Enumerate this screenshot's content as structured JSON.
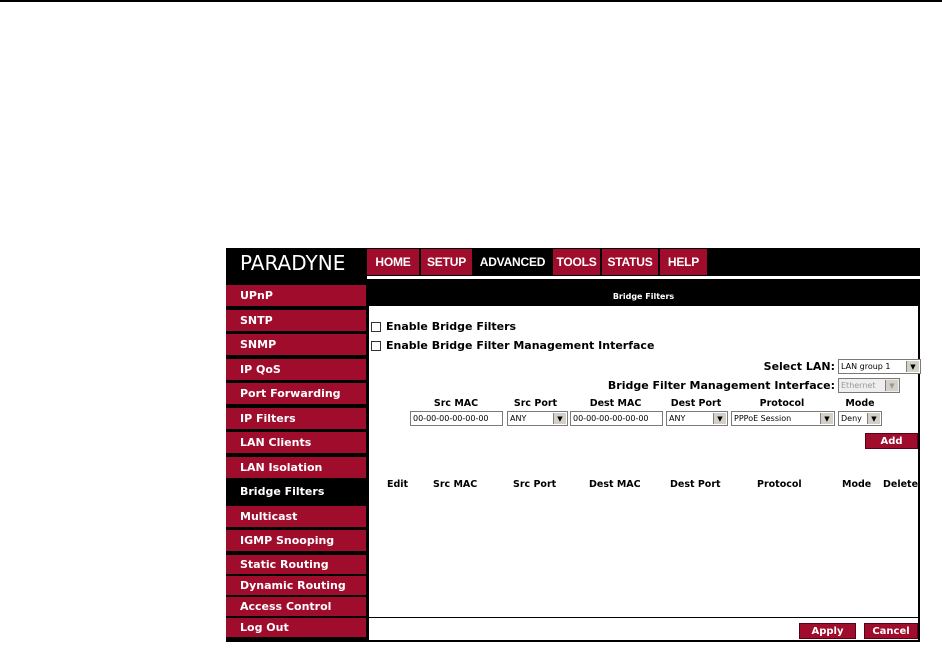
{
  "brand": {
    "logo": "PARADYNE"
  },
  "nav": {
    "tabs": [
      {
        "label": "HOME",
        "active": false
      },
      {
        "label": "SETUP",
        "active": false
      },
      {
        "label": "ADVANCED",
        "active": true
      },
      {
        "label": "TOOLS",
        "active": false
      },
      {
        "label": "STATUS",
        "active": false
      },
      {
        "label": "HELP",
        "active": false
      }
    ]
  },
  "sidebar": {
    "items": [
      {
        "label": "UPnP",
        "active": false
      },
      {
        "label": "SNTP",
        "active": false
      },
      {
        "label": "SNMP",
        "active": false
      },
      {
        "label": "IP QoS",
        "active": false
      },
      {
        "label": "Port Forwarding",
        "active": false
      },
      {
        "label": "IP Filters",
        "active": false
      },
      {
        "label": "LAN Clients",
        "active": false
      },
      {
        "label": "LAN Isolation",
        "active": false
      },
      {
        "label": "Bridge Filters",
        "active": true
      },
      {
        "label": "Multicast",
        "active": false
      },
      {
        "label": "IGMP Snooping",
        "active": false
      },
      {
        "label": "Static Routing",
        "active": false
      },
      {
        "label": "Dynamic Routing",
        "active": false
      },
      {
        "label": "Access Control",
        "active": false
      },
      {
        "label": "Log Out",
        "active": false
      }
    ]
  },
  "content": {
    "title": "Bridge Filters",
    "enable_filters": "Enable Bridge Filters",
    "enable_mgmt": "Enable Bridge Filter Management Interface",
    "select_lan_label": "Select LAN:",
    "select_lan_value": "LAN group 1",
    "mgmt_iface_label": "Bridge Filter Management Interface:",
    "mgmt_iface_value": "Ethernet",
    "form": {
      "headers": {
        "src_mac": "Src MAC",
        "src_port": "Src Port",
        "dest_mac": "Dest MAC",
        "dest_port": "Dest Port",
        "protocol": "Protocol",
        "mode": "Mode"
      },
      "src_mac": "00-00-00-00-00-00",
      "src_port": "ANY",
      "dest_mac": "00-00-00-00-00-00",
      "dest_port": "ANY",
      "protocol": "PPPoE Session",
      "mode": "Deny",
      "add_label": "Add"
    },
    "list_headers": {
      "edit": "Edit",
      "src_mac": "Src MAC",
      "src_port": "Src Port",
      "dest_mac": "Dest MAC",
      "dest_port": "Dest Port",
      "protocol": "Protocol",
      "mode": "Mode",
      "delete": "Delete"
    },
    "apply_label": "Apply",
    "cancel_label": "Cancel"
  },
  "colors": {
    "accent": "#a00c2c",
    "frame": "#000000"
  }
}
